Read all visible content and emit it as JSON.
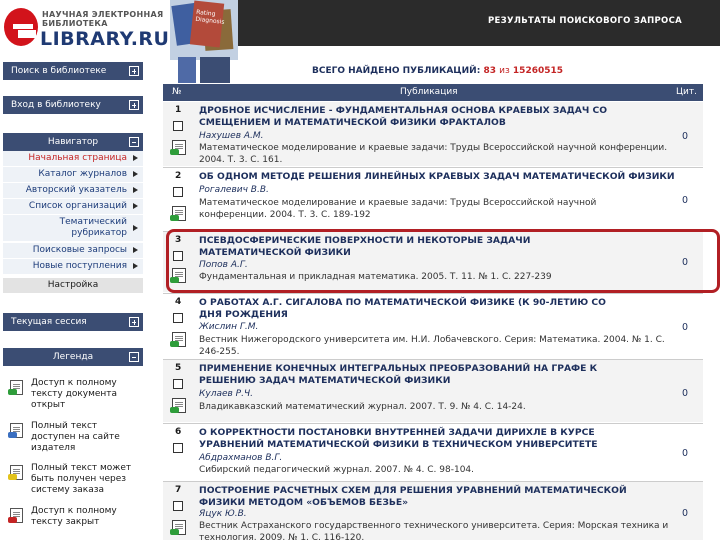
{
  "logo": {
    "line1": "НАУЧНАЯ ЭЛЕКТРОННАЯ",
    "line2": "БИБЛИОТЕКА",
    "line3": "LIBRARY.RU",
    "book_text": "Rating Diagnosis"
  },
  "header": {
    "title": "РЕЗУЛЬТАТЫ ПОИСКОВОГО ЗАПРОСА"
  },
  "sidebar": {
    "search_label": "Поиск в библиотеке",
    "login_label": "Вход в библиотеку",
    "navigator_label": "Навигатор",
    "nav_items": [
      "Начальная страница",
      "Каталог журналов",
      "Авторский указатель",
      "Список организаций",
      "Тематический рубрикатор",
      "Поисковые запросы",
      "Новые поступления"
    ],
    "settings_label": "Настройка",
    "session_label": "Текущая сессия",
    "legend_label": "Легенда",
    "legend_items": [
      "Доступ к полному тексту документа открыт",
      "Полный текст доступен на сайте издателя",
      "Полный текст может быть получен через систему заказа",
      "Доступ к полному тексту закрыт"
    ]
  },
  "summary": {
    "prefix": "ВСЕГО НАЙДЕНО ПУБЛИКАЦИЙ:",
    "found": "83",
    "of": "из",
    "total": "15260515"
  },
  "table": {
    "col_num": "№",
    "col_pub": "Публикация",
    "col_cit": "Цит.",
    "rows": [
      {
        "num": "1",
        "title": "ДРОБНОЕ ИСЧИСЛЕНИЕ - ФУНДАМЕНТАЛЬНАЯ ОСНОВА КРАЕВЫХ ЗАДАЧ СО СМЕЩЕНИЕМ И МАТЕМАТИЧЕСКОЙ ФИЗИКИ ФРАКТАЛОВ",
        "author": "Нахушев А.М.",
        "source": "Математическое моделирование и краевые задачи: Труды Всероссийской научной конференции. 2004. Т. 3. С. 161.",
        "cit": "0"
      },
      {
        "num": "2",
        "title": "ОБ ОДНОМ МЕТОДЕ РЕШЕНИЯ ЛИНЕЙНЫХ КРАЕВЫХ ЗАДАЧ МАТЕМАТИЧЕСКОЙ ФИЗИКИ",
        "author": "Рогалевич В.В.",
        "source": "Математическое моделирование и краевые задачи: Труды Всероссийской научной конференции. 2004. Т. 3. С. 189-192",
        "cit": "0"
      },
      {
        "num": "3",
        "title": "ПСЕВДОСФЕРИЧЕСКИЕ ПОВЕРХНОСТИ И НЕКОТОРЫЕ ЗАДАЧИ МАТЕМАТИЧЕСКОЙ ФИЗИКИ",
        "author": "Попов А.Г.",
        "source": "Фундаментальная и прикладная математика. 2005. Т. 11. № 1. С. 227-239",
        "cit": "0"
      },
      {
        "num": "4",
        "title": "О РАБОТАХ А.Г. СИГАЛОВА ПО МАТЕМАТИЧЕСКОЙ ФИЗИКЕ (К 90-ЛЕТИЮ СО ДНЯ РОЖДЕНИЯ",
        "author": "Жислин Г.М.",
        "source": "Вестник Нижегородского университета им. Н.И. Лобачевского. Серия: Математика. 2004. № 1. С. 246-255.",
        "cit": "0"
      },
      {
        "num": "5",
        "title": "ПРИМЕНЕНИЕ КОНЕЧНЫХ ИНТЕГРАЛЬНЫХ ПРЕОБРАЗОВАНИЙ НА ГРАФЕ К РЕШЕНИЮ ЗАДАЧ МАТЕМАТИЧЕСКОЙ ФИЗИКИ",
        "author": "Кулаев Р.Ч.",
        "source": "Владикавказский математический журнал. 2007. Т. 9. № 4. С. 14-24.",
        "cit": "0"
      },
      {
        "num": "6",
        "title": "О КОРРЕКТНОСТИ ПОСТАНОВКИ ВНУТРЕННЕЙ ЗАДАЧИ ДИРИХЛЕ В КУРСЕ УРАВНЕНИЙ МАТЕМАТИЧЕСКОЙ ФИЗИКИ В ТЕХНИЧЕСКОМ УНИВЕРСИТЕТЕ",
        "author": "Абдрахманов В.Г.",
        "source": "Сибирский педагогический журнал. 2007. № 4. С. 98-104.",
        "cit": "0"
      },
      {
        "num": "7",
        "title": "ПОСТРОЕНИЕ РАСЧЕТНЫХ СХЕМ ДЛЯ РЕШЕНИЯ УРАВНЕНИЙ МАТЕМАТИЧЕСКОЙ ФИЗИКИ МЕТОДОМ «ОБЪЕМОВ БЕЗЬЕ»",
        "author": "Яцук Ю.В.",
        "source": "Вестник Астраханского государственного технического университета. Серия: Морская техника и технология. 2009. № 1. С. 116-120.",
        "cit": "0"
      }
    ]
  },
  "colors": {
    "brand_red": "#d2131b",
    "brand_blue": "#1f3a73",
    "nav_bar": "#3b4d73",
    "header_dark": "#2b2b2b",
    "highlight": "#b11f24",
    "legend_green": "#2e9d3a",
    "legend_yellow": "#e2c21a",
    "legend_red": "#c42525"
  }
}
